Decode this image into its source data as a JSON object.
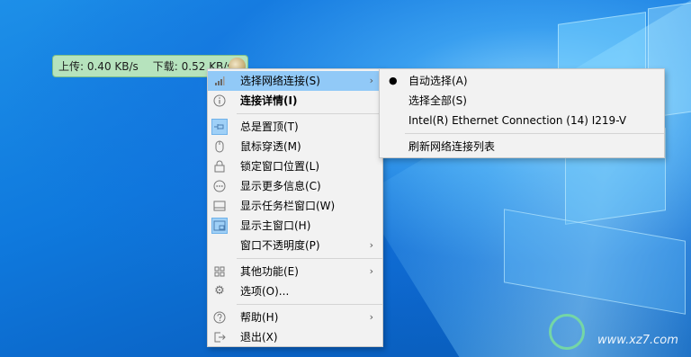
{
  "widget": {
    "upload": "上传: 0.40 KB/s",
    "download": "下载: 0.52 KB/s"
  },
  "main_menu": {
    "items": [
      {
        "label": "选择网络连接(S)",
        "icon": "signal-icon"
      },
      {
        "label": "连接详情(I)",
        "icon": "info-icon"
      },
      {
        "label": "总是置顶(T)",
        "icon": "pin-icon"
      },
      {
        "label": "鼠标穿透(M)",
        "icon": "mouse-icon"
      },
      {
        "label": "锁定窗口位置(L)",
        "icon": "lock-icon"
      },
      {
        "label": "显示更多信息(C)",
        "icon": "more-icon"
      },
      {
        "label": "显示任务栏窗口(W)",
        "icon": "taskbar-icon"
      },
      {
        "label": "显示主窗口(H)",
        "icon": "window-icon"
      },
      {
        "label": "窗口不透明度(P)",
        "icon": ""
      },
      {
        "label": "其他功能(E)",
        "icon": "grid-icon"
      },
      {
        "label": "选项(O)...",
        "icon": "gear-icon"
      },
      {
        "label": "帮助(H)",
        "icon": "help-icon"
      },
      {
        "label": "退出(X)",
        "icon": "exit-icon"
      }
    ]
  },
  "sub_menu": {
    "items": [
      {
        "label": "自动选择(A)",
        "selected": true
      },
      {
        "label": "选择全部(S)"
      },
      {
        "label": "Intel(R) Ethernet Connection (14) I219-V"
      },
      {
        "label": "刷新网络连接列表"
      }
    ]
  },
  "watermark": {
    "url": "www.xz7.com"
  },
  "colors": {
    "menu_highlight": "#91c9f7",
    "widget_bg": "#b6e3bd",
    "desktop_blue": "#0a6fcf"
  }
}
